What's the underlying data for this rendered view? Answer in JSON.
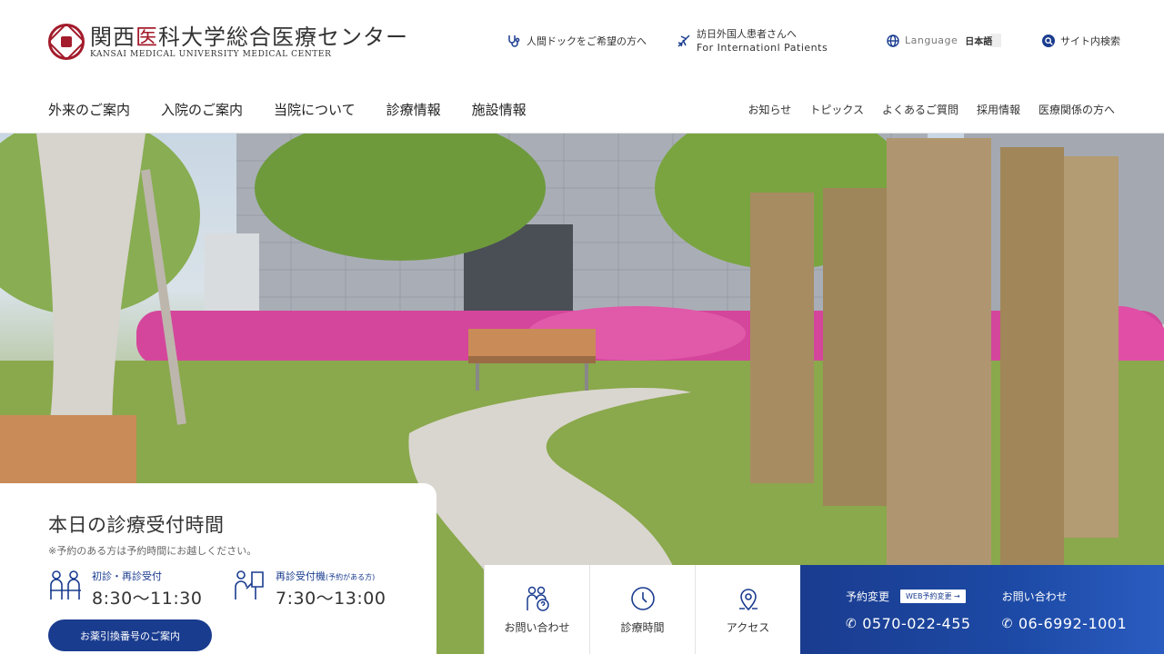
{
  "logo": {
    "jp_prefix": "関西",
    "jp_red": "医",
    "jp_suffix": "科大学総合医療センター",
    "en": "KANSAI MEDICAL UNIVERSITY MEDICAL CENTER"
  },
  "util": {
    "dock": "人間ドックをご希望の方へ",
    "intl_jp": "訪日外国人患者さんへ",
    "intl_en": "For Internationl Patients",
    "lang_label": "Language",
    "lang_value": "日本語",
    "search": "サイト内検索"
  },
  "gnav": [
    "外来のご案内",
    "入院のご案内",
    "当院について",
    "診療情報",
    "施設情報"
  ],
  "snav": [
    "お知らせ",
    "トピックス",
    "よくあるご質問",
    "採用情報",
    "医療関係の方へ"
  ],
  "hours": {
    "title": "本日の診療受付時間",
    "note": "※予約のある方は予約時間にお越しください。",
    "slot1_label": "初診・再診受付",
    "slot1_time": "8:30〜11:30",
    "slot2_label": "再診受付機",
    "slot2_label_small": "(予約がある方)",
    "slot2_time": "7:30〜13:00",
    "button": "お薬引換番号のご案内"
  },
  "quick": [
    "お問い合わせ",
    "診療時間",
    "アクセス"
  ],
  "contact": {
    "change_label": "予約変更",
    "web_button": "WEB予約変更 →",
    "change_tel": "0570-022-455",
    "inquiry_label": "お問い合わせ",
    "inquiry_tel": "06-6992-1001"
  },
  "colors": {
    "brand_red": "#a31c2c",
    "brand_blue": "#1a3c8f"
  }
}
